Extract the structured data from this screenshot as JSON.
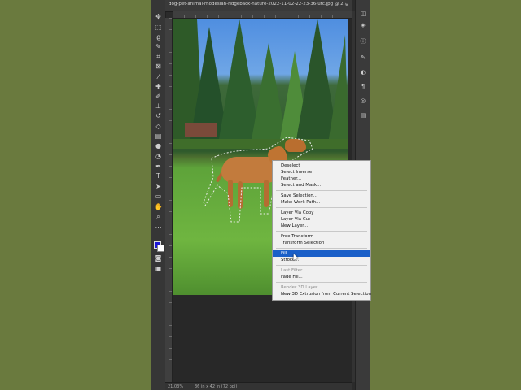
{
  "document": {
    "tab_title": "dog-pet-animal-rhodesian-ridgeback-nature-2022-11-02-22-23-36-utc.jpg @ 2...",
    "close_glyph": "×"
  },
  "tools": [
    "move-icon",
    "marquee-icon",
    "lasso-icon",
    "quick-select-icon",
    "crop-icon",
    "frame-icon",
    "eyedropper-icon",
    "healing-icon",
    "brush-icon",
    "clone-stamp-icon",
    "history-brush-icon",
    "eraser-icon",
    "gradient-icon",
    "blur-icon",
    "dodge-icon",
    "pen-icon",
    "type-icon",
    "path-select-icon",
    "rectangle-icon",
    "hand-icon",
    "zoom-icon",
    "more-tools-icon"
  ],
  "colors": {
    "foreground": "#1c17d4",
    "background": "#ffffff",
    "menu_highlight": "#1a5fc8"
  },
  "status": {
    "zoom": "21.03%",
    "doc_size": "36 in x 42 in (72 ppi)"
  },
  "context_menu": {
    "items": [
      {
        "label": "Deselect",
        "enabled": true
      },
      {
        "label": "Select Inverse",
        "enabled": true
      },
      {
        "label": "Feather...",
        "enabled": true
      },
      {
        "label": "Select and Mask...",
        "enabled": true
      },
      {
        "label": "Save Selection...",
        "enabled": true
      },
      {
        "label": "Make Work Path...",
        "enabled": true
      },
      {
        "label": "Layer Via Copy",
        "enabled": true
      },
      {
        "label": "Layer Via Cut",
        "enabled": true
      },
      {
        "label": "New Layer...",
        "enabled": true
      },
      {
        "label": "Free Transform",
        "enabled": true
      },
      {
        "label": "Transform Selection",
        "enabled": true
      },
      {
        "label": "Fill...",
        "enabled": true,
        "highlighted": true
      },
      {
        "label": "Stroke...",
        "enabled": true
      },
      {
        "label": "Last Filter",
        "enabled": false
      },
      {
        "label": "Fade Fill...",
        "enabled": true
      },
      {
        "label": "Render 3D Layer",
        "enabled": false
      },
      {
        "label": "New 3D Extrusion from Current Selection",
        "enabled": true
      }
    ]
  },
  "panel_icons": [
    "layers-icon",
    "stack-icon",
    "info-icon",
    "brush-settings-icon",
    "adjust-icon",
    "paragraph-icon",
    "channels-icon",
    "properties-icon"
  ]
}
